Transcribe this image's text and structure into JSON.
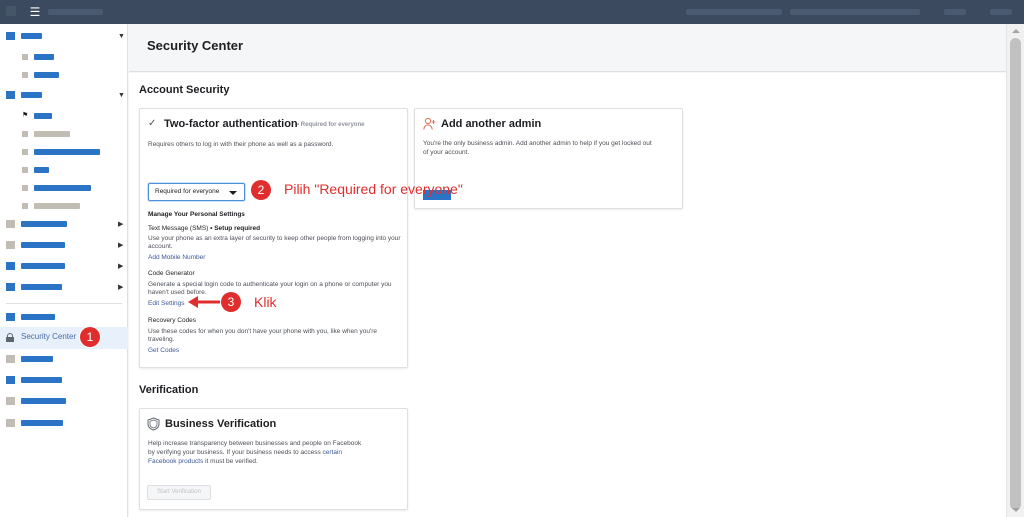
{
  "topbar": {
    "menu_icon": "hamburger-icon"
  },
  "sidebar": {
    "active_item": {
      "label": "Security Center",
      "icon": "lock-icon"
    }
  },
  "annotations": {
    "step1": "1",
    "step2": "2",
    "step2_text": "Pilih \"Required for everyone\"",
    "step3": "3",
    "step3_text": "Klik"
  },
  "page": {
    "title": "Security Center"
  },
  "account_security": {
    "heading": "Account Security",
    "two_factor": {
      "title": "Two-factor authentication",
      "tag": "• Required for everyone",
      "description": "Requires others to log in with their phone as well as a password.",
      "select_value": "Required for everyone",
      "personal_heading": "Manage Your Personal Settings",
      "sms_label": "Text Message (SMS)",
      "sms_status": "• Setup required",
      "sms_desc_1": "Use your phone as an extra layer of security to keep other people from logging into your",
      "sms_desc_2": "account.",
      "sms_link": "Add Mobile Number",
      "codegen_label": "Code Generator",
      "codegen_desc_1": "Generate a special login code to authenticate your login on a phone or computer you",
      "codegen_desc_2": "haven't used before.",
      "codegen_link": "Edit Settings",
      "recovery_label": "Recovery Codes",
      "recovery_desc_1": "Use these codes for when you don't have your phone with you, like when you're",
      "recovery_desc_2": "traveling.",
      "recovery_link": "Get Codes"
    },
    "add_admin": {
      "title": "Add another admin",
      "desc_1": "You're the only business admin. Add another admin to help if you get locked out",
      "desc_2": "of your account."
    }
  },
  "verification": {
    "heading": "Verification",
    "card": {
      "title": "Business Verification",
      "desc_1": "Help increase transparency between businesses and people on Facebook",
      "desc_2": "by verifying your business. If your business needs to access",
      "desc_2_link": "certain",
      "desc_3_link": "Facebook products",
      "desc_3": "it must be verified.",
      "button": "Start Verification"
    }
  },
  "colors": {
    "accent": "#2b73c4",
    "annotation": "#e02e2e",
    "link": "#3b5998",
    "topbar": "#3b4a5e"
  }
}
